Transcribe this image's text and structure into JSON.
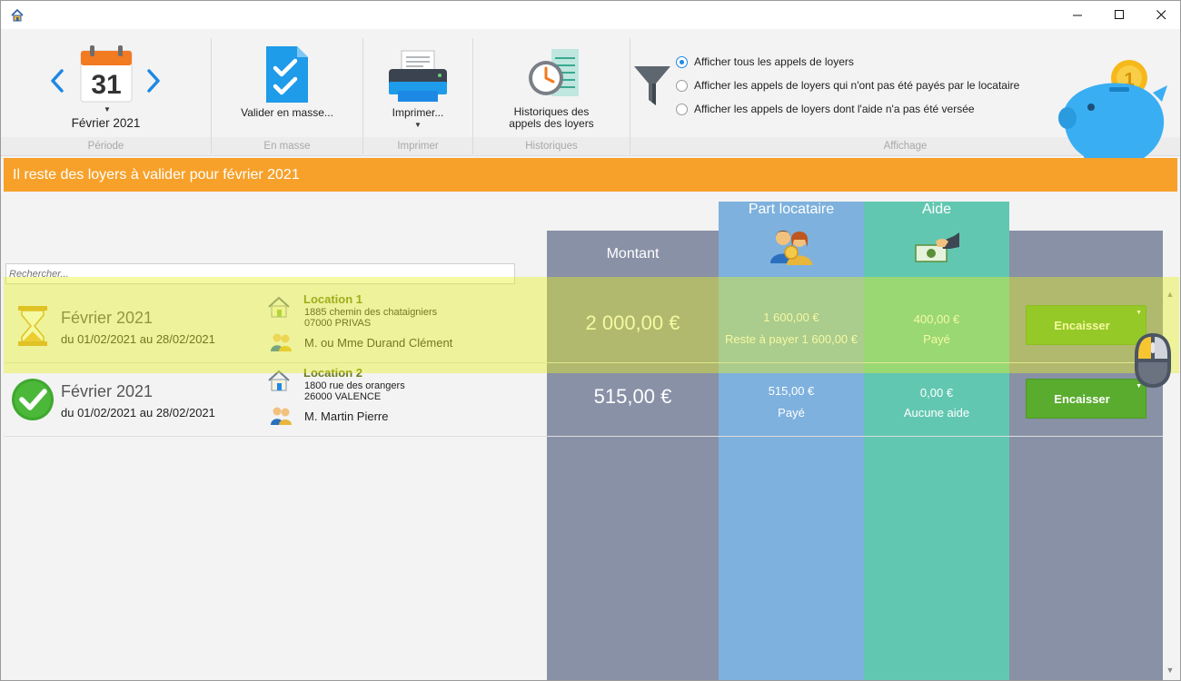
{
  "ribbon": {
    "periode": {
      "day": "31",
      "month_label": "Février 2021",
      "group_label": "Période"
    },
    "masse": {
      "button_label": "Valider en masse...",
      "group_label": "En masse"
    },
    "imprimer": {
      "button_label": "Imprimer...",
      "group_label": "Imprimer"
    },
    "historiques": {
      "button_label_line1": "Historiques des",
      "button_label_line2": "appels des loyers",
      "group_label": "Historiques"
    },
    "affichage": {
      "options": [
        "Afficher tous les appels de loyers",
        "Afficher les appels de loyers qui n'ont pas été payés par le locataire",
        "Afficher les appels de loyers dont l'aide n'a pas été versée"
      ],
      "selected_index": 0,
      "group_label": "Affichage"
    }
  },
  "banner": {
    "text": "Il reste des loyers à valider pour février 2021",
    "color": "#f7a12a"
  },
  "columns": {
    "montant": "Montant",
    "part_locataire": "Part locataire",
    "aide": "Aide"
  },
  "search": {
    "placeholder": "Rechercher..."
  },
  "rows": [
    {
      "status": "hourglass-icon",
      "period_title": "Février 2021",
      "period_range": "du 01/02/2021 au 28/02/2021",
      "location_title": "Location 1",
      "address_line1": "1885 chemin des chataigniers",
      "address_line2": "07000 PRIVAS",
      "tenant": "M. ou Mme Durand Clément",
      "montant": "2 000,00 €",
      "part_amount": "1 600,00 €",
      "part_status": "Reste à payer 1 600,00 €",
      "aide_amount": "400,00 €",
      "aide_status": "Payé",
      "action": "Encaisser"
    },
    {
      "status": "check-icon",
      "period_title": "Février 2021",
      "period_range": "du 01/02/2021 au 28/02/2021",
      "location_title": "Location 2",
      "address_line1": "1800 rue des orangers",
      "address_line2": "26000 VALENCE",
      "tenant": "M. Martin Pierre",
      "montant": "515,00 €",
      "part_amount": "515,00 €",
      "part_status": "Payé",
      "aide_amount": "0,00 €",
      "aide_status": "Aucune aide",
      "action": "Encaisser"
    }
  ],
  "colors": {
    "montant_col": "#8891a6",
    "part_col": "#7eb1dd",
    "aide_col": "#62c7b1",
    "button_green": "#5aac2e",
    "highlight": "#e6f01e"
  }
}
